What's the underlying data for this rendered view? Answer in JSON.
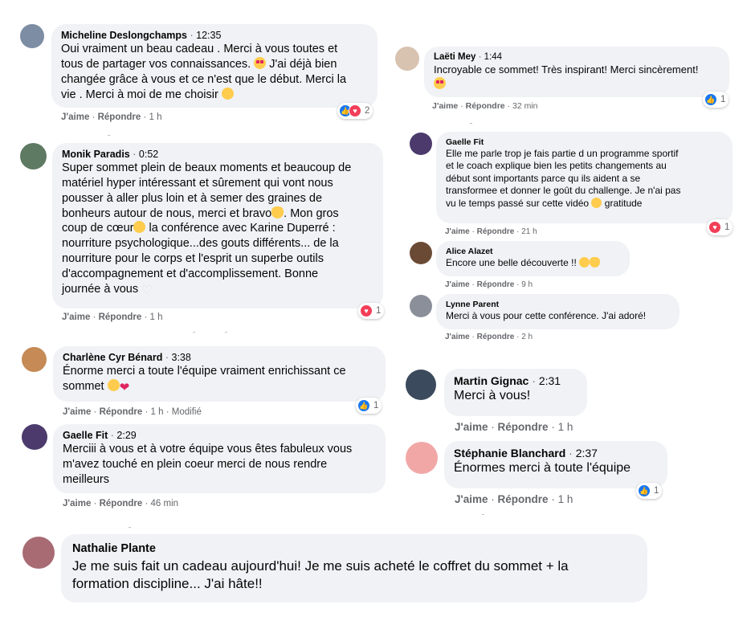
{
  "comments": [
    {
      "author": "Micheline Deslongchamps",
      "time": "12:35",
      "lines": [
        "Oui vraiment un beau cadeau . Merci à vous toutes et",
        "tous de partager vos connaissances. ",
        " J'ai déjà bien",
        "changée grâce à vous et ce n'est que le début. Merci la",
        "vie . Merci à moi de me choisir "
      ],
      "like": "J'aime",
      "reply": "Répondre",
      "ago": "1 h",
      "reaction_count": "2",
      "avatar_color": "#7d8da3"
    },
    {
      "author": "Monik Paradis",
      "time": "0:52",
      "lines": [
        "Super sommet plein de beaux moments et beaucoup de",
        "matériel hyper intéressant et sûrement qui vont nous",
        "pousser à aller plus loin et à semer des graines de",
        "bonheurs autour de nous, merci et bravo",
        ". Mon gros",
        "coup de cœur",
        " la conférence avec Karine Duperré :",
        "nourriture psychologique...des gouts différents... de la",
        "nourriture pour le corps et l'esprit un superbe outils",
        "d'accompagnement et d'accomplissement. Bonne",
        "journée à vous "
      ],
      "like": "J'aime",
      "reply": "Répondre",
      "ago": "1 h",
      "reaction_count": "1",
      "avatar_color": "#5f7a63"
    },
    {
      "author": "Charlène Cyr Bénard",
      "time": "3:38",
      "lines": [
        "Énorme merci a toute l'équipe vraiment enrichissant ce",
        "sommet "
      ],
      "like": "J'aime",
      "reply": "Répondre",
      "ago": "1 h",
      "edited": "Modifié",
      "reaction_count": "1",
      "avatar_color": "#c58a55"
    },
    {
      "author": "Gaelle Fit",
      "time": "2:29",
      "lines": [
        "Merciii à vous et à votre équipe vous êtes fabuleux vous",
        "m'avez touché en plein coeur merci de nous rendre",
        "meilleurs"
      ],
      "like": "J'aime",
      "reply": "Répondre",
      "ago": "46 min",
      "avatar_color": "#4b3a6b"
    },
    {
      "author": "Nathalie Plante",
      "time": "",
      "lines": [
        "Je me suis fait un cadeau aujourd'hui! Je me suis acheté le coffret du sommet + la",
        "formation discipline... J'ai hâte!!"
      ],
      "avatar_color": "#a86b73"
    },
    {
      "author": "Laëti Mey",
      "time": "1:44",
      "lines": [
        "Incroyable ce sommet! Très inspirant! Merci sincèrement!"
      ],
      "like": "J'aime",
      "reply": "Répondre",
      "ago": "32 min",
      "reaction_count": "1",
      "avatar_color": "#d8c2b0"
    },
    {
      "author": "Gaelle Fit",
      "time": "",
      "lines": [
        "Elle me parle trop je fais partie d un programme sportif",
        "et le coach explique bien les petits changements au",
        "début sont importants parce qu ils aident a se",
        "transformee et donner le goût du challenge. Je n'ai pas",
        "vu le temps passé sur cette vidéo ",
        " gratitude"
      ],
      "like": "J'aime",
      "reply": "Répondre",
      "ago": "21 h",
      "reaction_count": "1",
      "avatar_color": "#4b3a6b"
    },
    {
      "author": "Alice Alazet",
      "time": "",
      "lines": [
        "Encore une belle découverte !! "
      ],
      "like": "J'aime",
      "reply": "Répondre",
      "ago": "9 h",
      "avatar_color": "#6b4a35"
    },
    {
      "author": "Lynne Parent",
      "time": "",
      "lines": [
        "Merci à vous pour cette conférence. J'ai adoré!"
      ],
      "like": "J'aime",
      "reply": "Répondre",
      "ago": "2 h",
      "avatar_color": "#8a8f99"
    },
    {
      "author": "Martin Gignac",
      "time": "2:31",
      "lines": [
        "Merci à vous!"
      ],
      "like": "J'aime",
      "reply": "Répondre",
      "ago": "1 h",
      "avatar_color": "#3b4a5c"
    },
    {
      "author": "Stéphanie Blanchard",
      "time": "2:37",
      "lines": [
        "Énormes merci à toute l'équipe"
      ],
      "like": "J'aime",
      "reply": "Répondre",
      "ago": "1 h",
      "reaction_count": "1",
      "avatar_color": "#f2a7a7"
    }
  ],
  "separator": "·"
}
